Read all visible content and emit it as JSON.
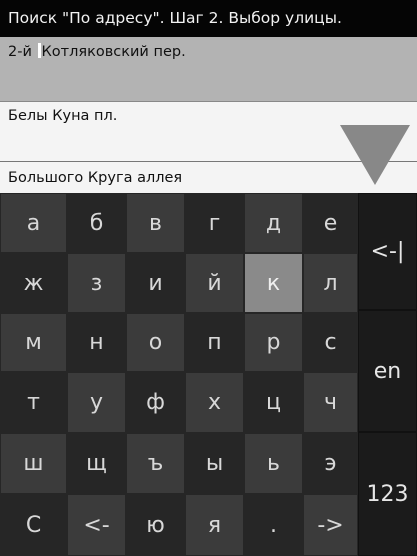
{
  "header": {
    "title": "Поиск \"По адресу\". Шаг 2. Выбор улицы."
  },
  "results": {
    "input_before_cursor": "2-й ",
    "input_after_cursor": "Котляковский пер.",
    "items": [
      "Белы Куна пл.",
      "Большого Круга аллея"
    ]
  },
  "keyboard": {
    "rows": [
      [
        "а",
        "б",
        "в",
        "г",
        "д",
        "е"
      ],
      [
        "ж",
        "з",
        "и",
        "й",
        "к",
        "л"
      ],
      [
        "м",
        "н",
        "о",
        "п",
        "р",
        "с"
      ],
      [
        "т",
        "у",
        "ф",
        "х",
        "ц",
        "ч"
      ],
      [
        "ш",
        "щ",
        "ъ",
        "ы",
        "ь",
        "э"
      ],
      [
        "С",
        "<-",
        "ю",
        "я",
        ".",
        "->"
      ]
    ],
    "pressed_key": "к",
    "side_keys": {
      "backspace": "<-|",
      "language": "en",
      "numbers": "123"
    }
  },
  "colors": {
    "pressed_key": "#8a8a8a",
    "key": "#3b3b3b",
    "scroll_arrow": "#888888"
  }
}
